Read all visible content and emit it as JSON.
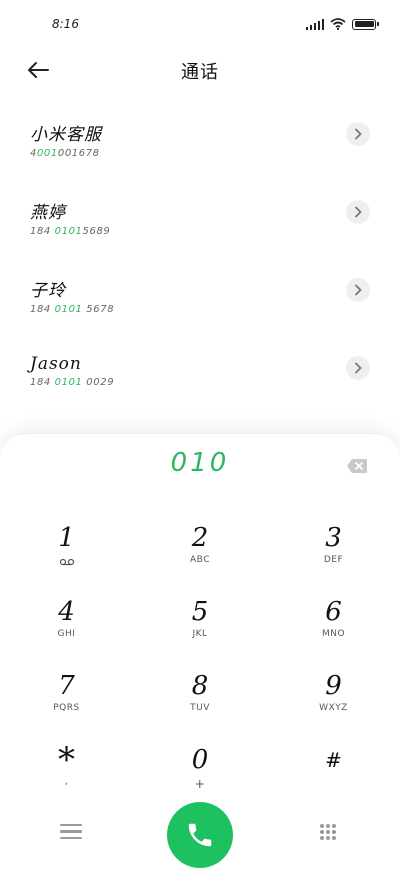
{
  "status_bar": {
    "time": "8:16",
    "icons": [
      "signal-icon",
      "wifi-icon",
      "battery-icon"
    ]
  },
  "header": {
    "title": "通话",
    "back_icon": "back-arrow-icon"
  },
  "contacts": [
    {
      "name": "小米客服",
      "number_parts": [
        "4",
        "001",
        "001678"
      ]
    },
    {
      "name": "燕婷",
      "number_parts": [
        "184 ",
        "0101",
        "5689"
      ]
    },
    {
      "name": "子玲",
      "number_parts": [
        "184 ",
        "0101",
        " 5678"
      ]
    },
    {
      "name": "Jason",
      "number_parts": [
        "184 ",
        "0101",
        " 0029"
      ]
    }
  ],
  "dialer": {
    "input": "010",
    "keys": [
      {
        "digit": "1",
        "letters": "",
        "icon": "voicemail-icon"
      },
      {
        "digit": "2",
        "letters": "ABC"
      },
      {
        "digit": "3",
        "letters": "DEF"
      },
      {
        "digit": "4",
        "letters": "GHI"
      },
      {
        "digit": "5",
        "letters": "JKL"
      },
      {
        "digit": "6",
        "letters": "MNO"
      },
      {
        "digit": "7",
        "letters": "PQRS"
      },
      {
        "digit": "8",
        "letters": "TUV"
      },
      {
        "digit": "9",
        "letters": "WXYZ"
      },
      {
        "digit": "*",
        "letters": ","
      },
      {
        "digit": "0",
        "letters": "+"
      },
      {
        "digit": "#",
        "letters": ""
      }
    ]
  },
  "colors": {
    "accent": "#2fb561",
    "call_button": "#1ec15f"
  }
}
